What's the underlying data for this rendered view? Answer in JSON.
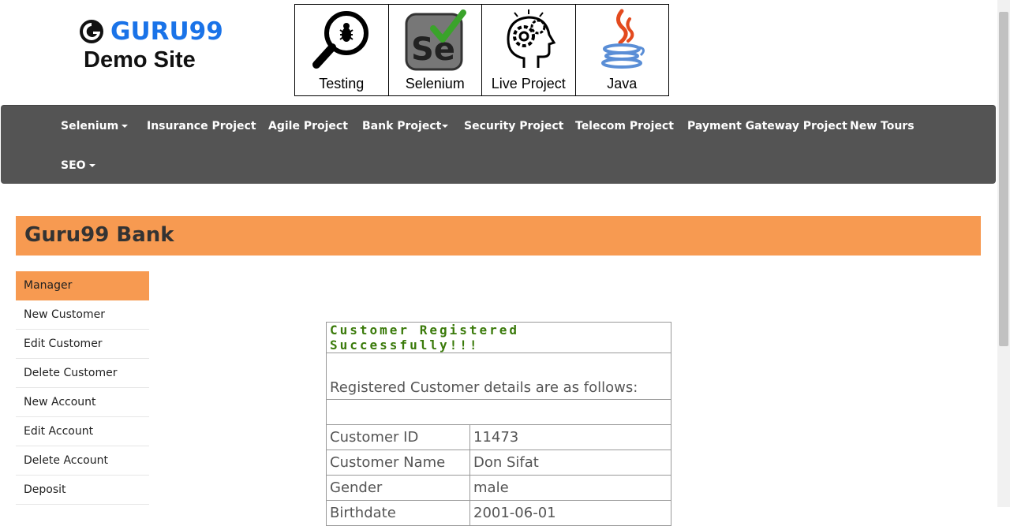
{
  "brand": {
    "name": "GURU99",
    "subtitle": "Demo Site",
    "accent": "#1a73e8"
  },
  "courses": [
    {
      "label": "Testing",
      "icon": "magnifier-bug-icon"
    },
    {
      "label": "Selenium",
      "icon": "selenium-icon"
    },
    {
      "label": "Live Project",
      "icon": "head-gears-icon"
    },
    {
      "label": "Java",
      "icon": "java-cup-icon"
    }
  ],
  "nav": {
    "items": [
      {
        "label": "Selenium",
        "dropdown": true
      },
      {
        "label": "Insurance Project",
        "dropdown": false
      },
      {
        "label": "Agile Project",
        "dropdown": false
      },
      {
        "label": "Bank Project",
        "dropdown": true
      },
      {
        "label": "Security Project",
        "dropdown": false
      },
      {
        "label": "Telecom Project",
        "dropdown": false
      },
      {
        "label": "Payment Gateway Project",
        "dropdown": false
      },
      {
        "label": "New Tours",
        "dropdown": false
      },
      {
        "label": "SEO",
        "dropdown": true
      }
    ],
    "background": "#545454"
  },
  "bank": {
    "title": "Guru99 Bank",
    "header_color": "#f79a51"
  },
  "sidebar": {
    "items": [
      {
        "label": "Manager",
        "active": true
      },
      {
        "label": "New Customer"
      },
      {
        "label": "Edit Customer"
      },
      {
        "label": "Delete Customer"
      },
      {
        "label": "New Account"
      },
      {
        "label": "Edit Account"
      },
      {
        "label": "Delete Account"
      },
      {
        "label": "Deposit"
      }
    ]
  },
  "result": {
    "title": "Customer Registered Successfully!!!",
    "subtitle": "Registered Customer details are as follows:",
    "rows": [
      {
        "label": "Customer ID",
        "value": "11473"
      },
      {
        "label": "Customer Name",
        "value": "Don Sifat"
      },
      {
        "label": "Gender",
        "value": "male"
      },
      {
        "label": "Birthdate",
        "value": "2001-06-01"
      }
    ]
  }
}
